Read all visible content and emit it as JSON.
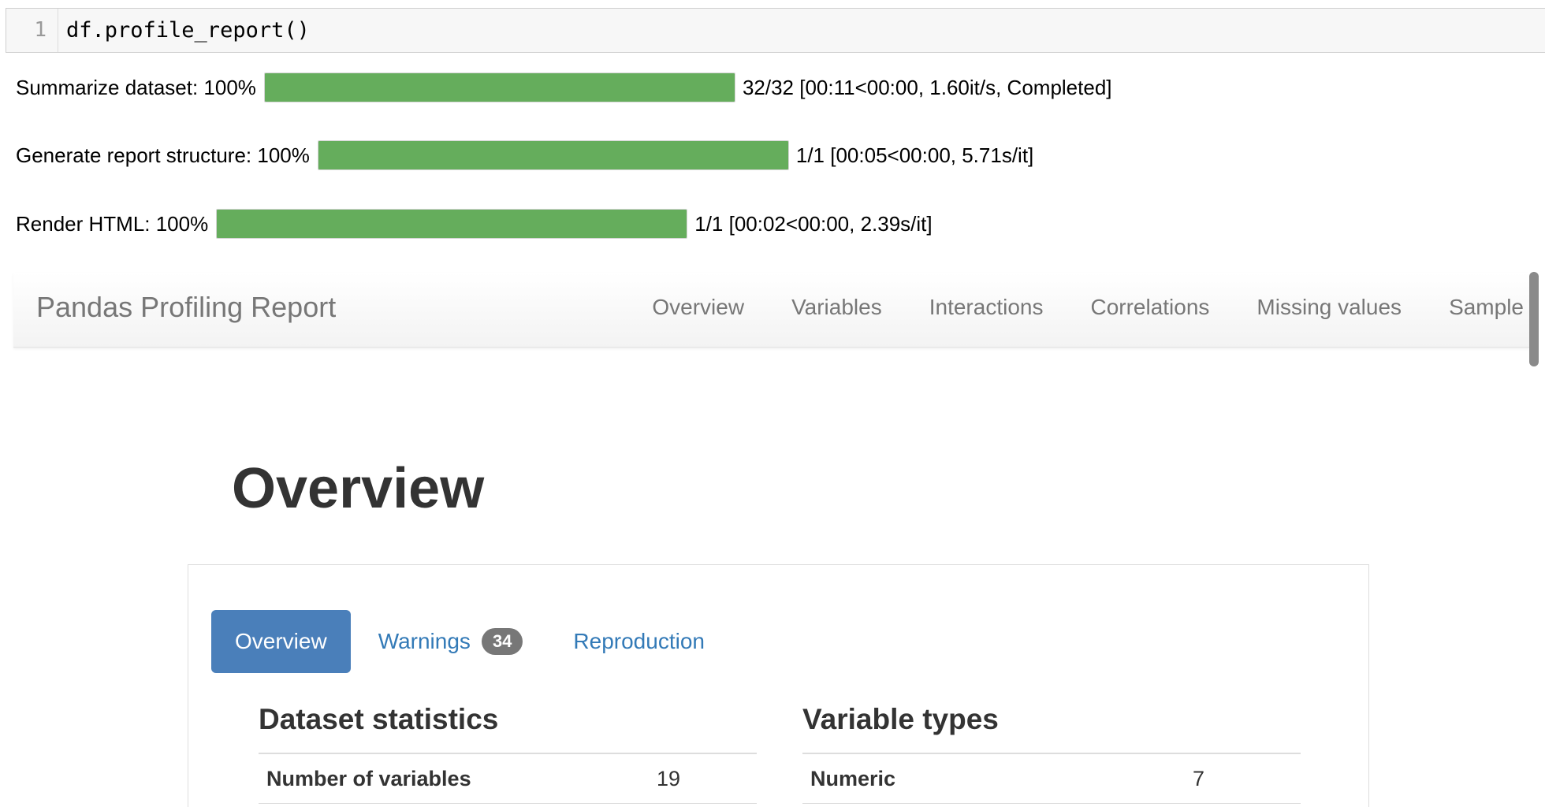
{
  "cell": {
    "line_number": "1",
    "code": "df.profile_report()"
  },
  "progress": [
    {
      "label": "Summarize dataset: 100%",
      "progress": 1.0,
      "stats": "32/32 [00:11<00:00, 1.60it/s, Completed]"
    },
    {
      "label": "Generate report structure: 100%",
      "progress": 1.0,
      "stats": "1/1 [00:05<00:00, 5.71s/it]"
    },
    {
      "label": "Render HTML: 100%",
      "progress": 1.0,
      "stats": "1/1 [00:02<00:00, 2.39s/it]"
    }
  ],
  "progress_color": "#65ad5c",
  "navbar": {
    "brand": "Pandas Profiling Report",
    "links": [
      "Overview",
      "Variables",
      "Interactions",
      "Correlations",
      "Missing values",
      "Sample"
    ]
  },
  "overview": {
    "title": "Overview",
    "tabs": [
      {
        "label": "Overview",
        "active": true
      },
      {
        "label": "Warnings",
        "badge": "34"
      },
      {
        "label": "Reproduction"
      }
    ],
    "dataset_statistics": {
      "heading": "Dataset statistics",
      "rows": [
        {
          "name": "Number of variables",
          "value": "19"
        }
      ]
    },
    "variable_types": {
      "heading": "Variable types",
      "rows": [
        {
          "name": "Numeric",
          "value": "7"
        }
      ]
    }
  },
  "accent_color": "#4a7fba"
}
